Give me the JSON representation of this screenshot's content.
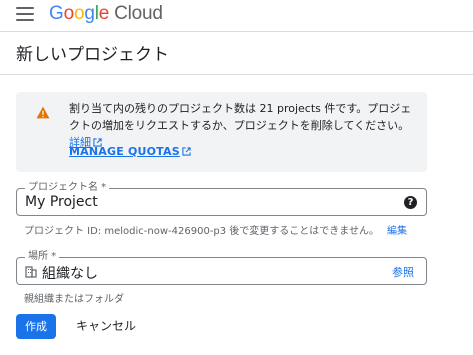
{
  "header": {
    "logo_letters": [
      "G",
      "o",
      "o",
      "g",
      "l",
      "e"
    ],
    "logo_product": "Cloud"
  },
  "page": {
    "title": "新しいプロジェクト"
  },
  "notice": {
    "text": "割り当て内の残りのプロジェクト数は 21 projects 件です。プロジェクトの増加をリクエストするか、プロジェクトを削除してください。",
    "details_link": "詳細",
    "manage_quotas": "MANAGE QUOTAS",
    "icon": "warning-icon",
    "icon_color": "#E37400"
  },
  "project_name": {
    "label": "プロジェクト名 *",
    "value": "My Project",
    "hint": "プロジェクト ID: melodic-now-426900-p3 後で変更することはできません。",
    "edit_link": "編集"
  },
  "location": {
    "label": "場所 *",
    "value": "組織なし",
    "browse": "参照",
    "hint": "親組織またはフォルダ"
  },
  "actions": {
    "create": "作成",
    "cancel": "キャンセル"
  },
  "colors": {
    "primary": "#1a73e8",
    "divider": "#dadce0",
    "notice_bg": "#f1f3f4"
  }
}
